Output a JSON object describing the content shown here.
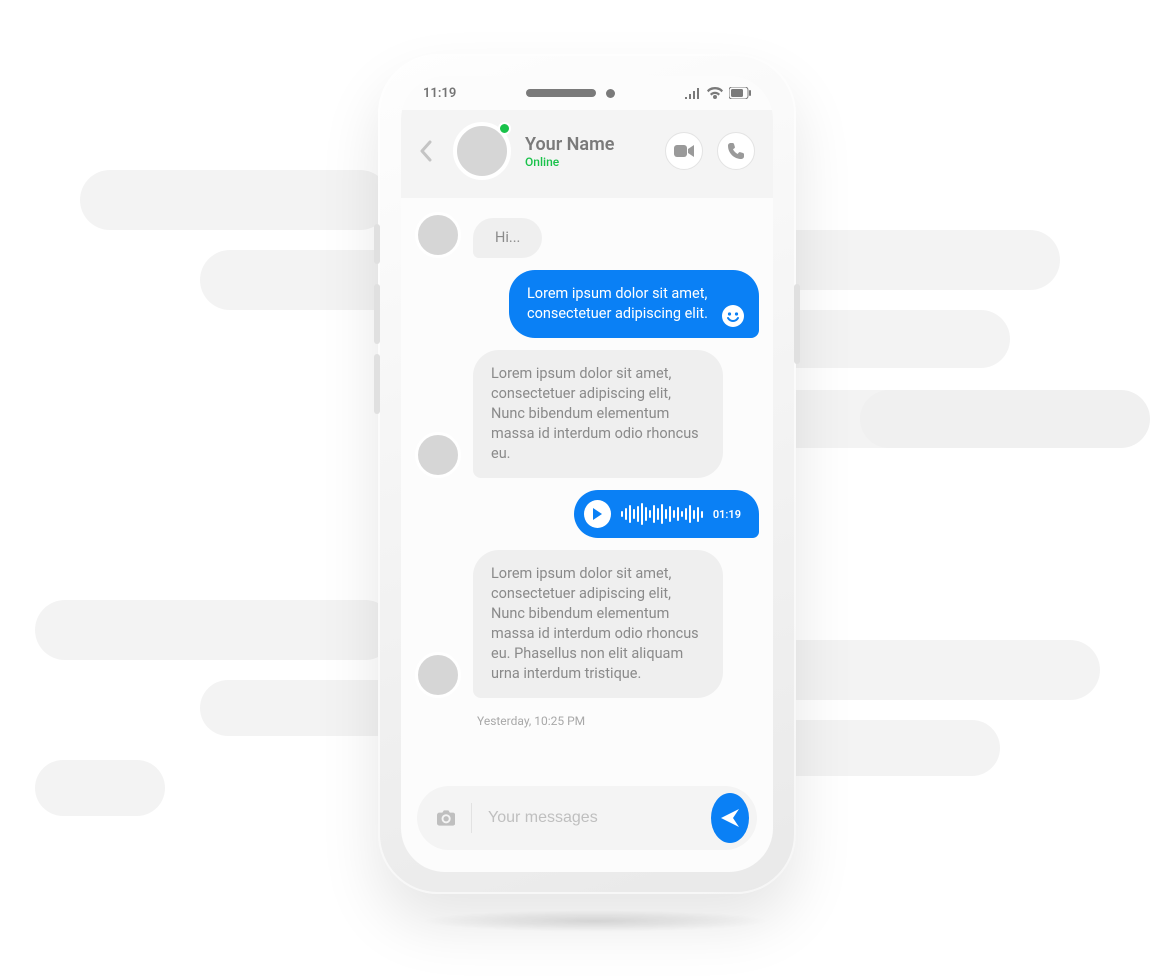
{
  "status_bar": {
    "time": "11:19"
  },
  "header": {
    "name": "Your Name",
    "status": "Online"
  },
  "messages": {
    "m0": "Hi...",
    "m1": "Lorem ipsum dolor sit amet, consectetuer adipiscing elit.",
    "m2": "Lorem ipsum dolor sit amet, consectetuer adipiscing elit, Nunc bibendum elementum massa id interdum odio rhoncus eu.",
    "voice_duration": "01:19",
    "m3": "Lorem ipsum dolor sit amet, consectetuer adipiscing elit, Nunc bibendum elementum massa id interdum odio rhoncus eu. Phasellus non elit aliquam urna interdum tristique.",
    "timestamp": "Yesterday, 10:25 PM"
  },
  "composer": {
    "placeholder": "Your messages"
  },
  "colors": {
    "accent": "#0a80f5",
    "online": "#19c24a"
  }
}
